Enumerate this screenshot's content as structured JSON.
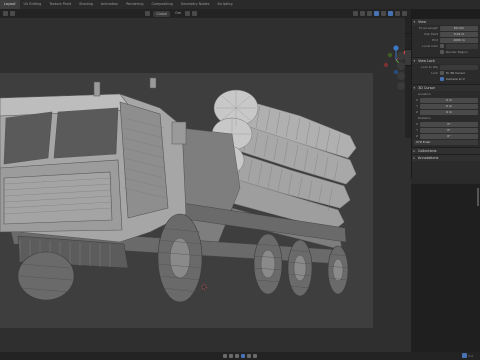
{
  "topbar": {
    "tabs": [
      "Layout",
      "UV Editing",
      "Texture Paint",
      "Shading",
      "Animation",
      "Rendering",
      "Compositing",
      "Geometry Nodes",
      "Scripting"
    ],
    "active_tab_index": 0
  },
  "header": {
    "transform_orientation": "Global",
    "pivot_label": "Gm"
  },
  "npanel": {
    "view": {
      "title": "View",
      "focal_length_label": "Focal Length",
      "focal_length": "50 mm",
      "clip_start_label": "Clip Start",
      "clip_start": "0.01 m",
      "clip_end_label": "End",
      "clip_end": "1000 m",
      "local_camera_label": "Local Cam",
      "render_region_label": "Render Region"
    },
    "view_lock": {
      "title": "View Lock",
      "lock_object_label": "Lock to Obj",
      "lock_label": "Lock",
      "to_3d_cursor": "To 3D Cursor",
      "camera_to_view": "Camera to V"
    },
    "cursor_3d": {
      "title": "3D Cursor",
      "location_label": "Location",
      "x": "0 m",
      "y": "0 m",
      "z": "0 m",
      "rotation_label": "Rotation",
      "rx": "0°",
      "ry": "0°",
      "rz": "0°",
      "rotation_mode": "XYZ Euler"
    },
    "collapsed": [
      "Collections",
      "Annotations"
    ]
  },
  "viewport": {
    "navigation": [
      "zoom",
      "pan",
      "camera",
      "perspective"
    ]
  },
  "playback": {
    "buttons": [
      "jump-start",
      "prev-keyframe",
      "play-reverse",
      "play",
      "next-keyframe",
      "jump-end"
    ],
    "active_index": 3
  },
  "status": {
    "corner_text": "3.4"
  },
  "colors": {
    "accent": "#4772b3",
    "axis_x": "#d04848",
    "axis_y": "#6ca33a",
    "axis_z": "#3c79c4"
  }
}
